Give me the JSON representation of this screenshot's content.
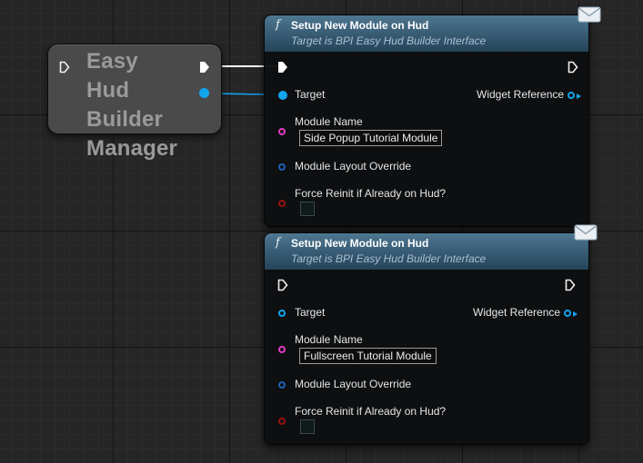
{
  "manager": {
    "title_lines": [
      "Easy Hud",
      "Builder",
      "Manager"
    ]
  },
  "nodes": [
    {
      "title": "Setup New Module on Hud",
      "subtitle": "Target is BPI Easy Hud Builder Interface",
      "target_label": "Target",
      "widget_ref_label": "Widget Reference",
      "module_name_label": "Module Name",
      "module_name_value": "Side Popup Tutorial Module",
      "layout_override_label": "Module Layout Override",
      "force_reinit_label": "Force Reinit if Already on Hud?"
    },
    {
      "title": "Setup New Module on Hud",
      "subtitle": "Target is BPI Easy Hud Builder Interface",
      "target_label": "Target",
      "widget_ref_label": "Widget Reference",
      "module_name_label": "Module Name",
      "module_name_value": "Fullscreen Tutorial Module",
      "layout_override_label": "Module Layout Override",
      "force_reinit_label": "Force Reinit if Already on Hud?"
    }
  ],
  "icons": {
    "function": "f",
    "message": "envelope-icon",
    "exec": "exec-pin-icon"
  },
  "colors": {
    "header": "#365a72",
    "object_pin": "#12a5f0",
    "string_pin": "#e03cc6",
    "struct_pin": "#1f5fb4",
    "bool_pin": "#9a1212"
  }
}
